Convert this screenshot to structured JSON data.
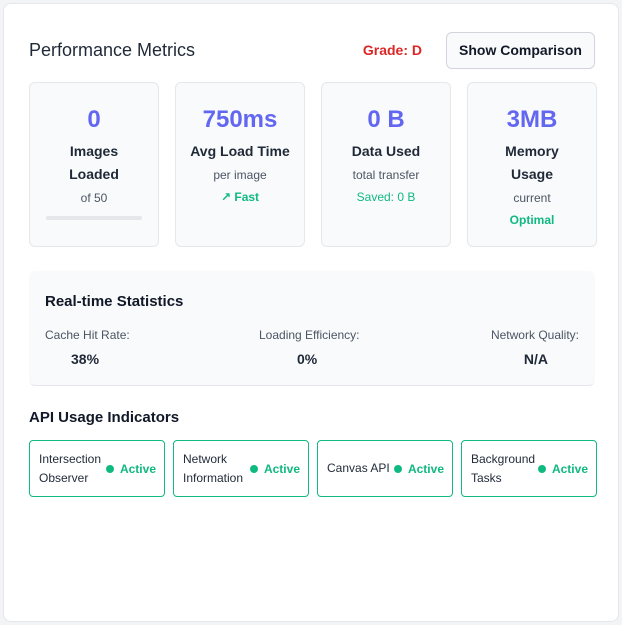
{
  "header": {
    "title": "Performance Metrics",
    "grade": "Grade: D",
    "grade_color": "#dc2626",
    "compare_button": "Show Comparison"
  },
  "metrics": [
    {
      "value": "0",
      "label": "Images Loaded",
      "sub": "of 50",
      "progress_fraction": 0
    },
    {
      "value": "750ms",
      "label": "Avg Load Time",
      "sub": "per image",
      "note": "↗ Fast"
    },
    {
      "value": "0 B",
      "label": "Data Used",
      "sub": "total transfer",
      "note": "Saved: 0 B"
    },
    {
      "value": "3MB",
      "label": "Memory Usage",
      "sub": "current",
      "note": "Optimal"
    }
  ],
  "realtime": {
    "title": "Real-time Statistics",
    "stats": [
      {
        "label": "Cache Hit Rate:",
        "value": "38%"
      },
      {
        "label": "Loading Efficiency:",
        "value": "0%"
      },
      {
        "label": "Network Quality:",
        "value": "N/A"
      }
    ]
  },
  "api": {
    "title": "API Usage Indicators",
    "items": [
      {
        "name": "Intersection Observer",
        "status": "Active"
      },
      {
        "name": "Network Information",
        "status": "Active"
      },
      {
        "name": "Canvas API",
        "status": "Active"
      },
      {
        "name": "Background Tasks",
        "status": "Active"
      }
    ]
  },
  "colors": {
    "accent": "#6366f1",
    "success": "#10b981"
  }
}
